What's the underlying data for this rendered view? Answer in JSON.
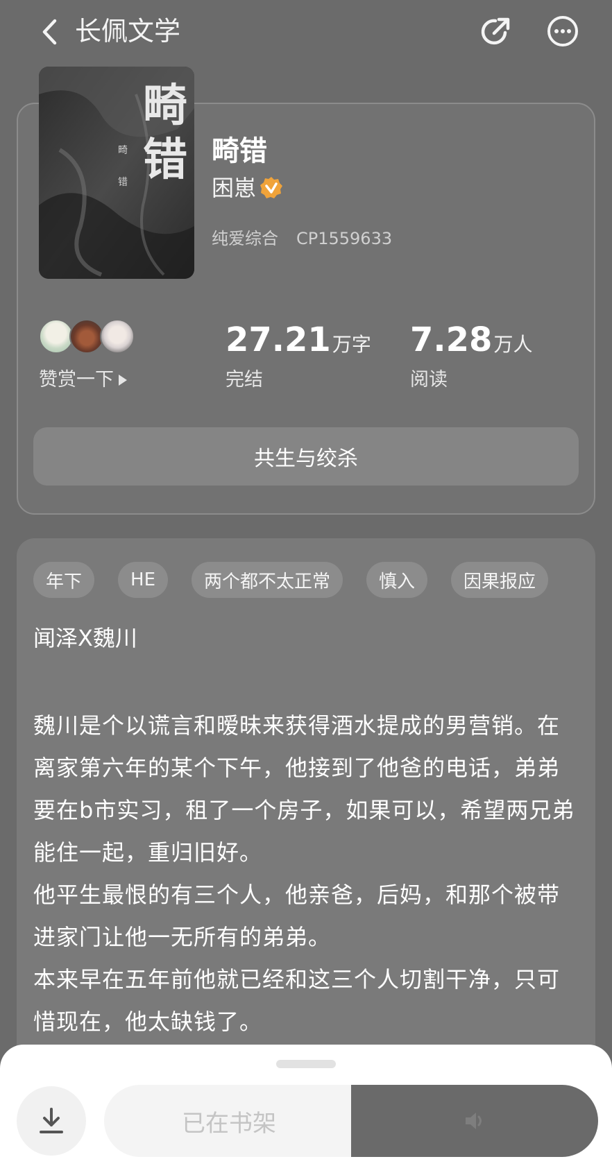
{
  "header": {
    "title": "长佩文学",
    "back_icon": "chevron-left-icon",
    "share_icon": "share-icon",
    "more_icon": "more-icon"
  },
  "book": {
    "cover_text": {
      "large": "畸错",
      "small_1": "畸",
      "small_2": "错"
    },
    "title": "畸错",
    "author": "困崽",
    "author_badge_color": "#f0a33a",
    "category": "纯爱综合",
    "pairing_code": "CP1559633"
  },
  "stats": {
    "reward_label": "赞赏一下",
    "word_count": "27.21",
    "word_unit": "万字",
    "word_label": "完结",
    "readers": "7.28",
    "readers_unit": "万人",
    "readers_label": "阅读"
  },
  "tagline": "共生与绞杀",
  "tags": [
    "年下",
    "HE",
    "两个都不太正常",
    "慎入",
    "因果报应"
  ],
  "description": {
    "pairing_line": "闻泽X魏川",
    "body": "魏川是个以谎言和暧昧来获得酒水提成的男营销。在离家第六年的某个下午，他接到了他爸的电话，弟弟要在b市实习，租了一个房子，如果可以，希望两兄弟能住一起，重归旧好。\n他平生最恨的有三个人，他亲爸，后妈，和那个被带进家门让他一无所有的弟弟。\n本来早在五年前他就已经和这三个人切割干净，只可惜现在，他太缺钱了。"
  },
  "bottom_bar": {
    "download_icon": "download-icon",
    "shelf_label": "已在书架",
    "read_icon": "speaker-icon"
  }
}
